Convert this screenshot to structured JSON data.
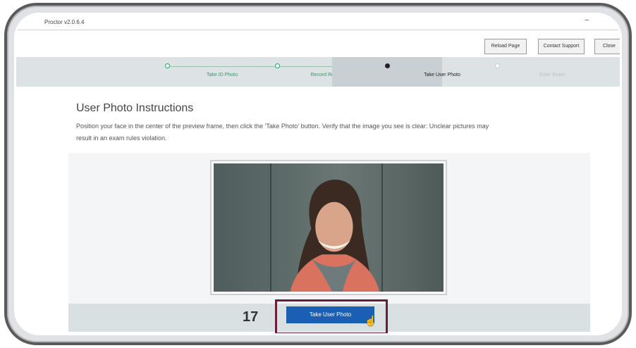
{
  "window": {
    "title": "Proctor v2.0.6.4",
    "minimize_glyph": "–"
  },
  "toolbar": {
    "reload_label": "Reload Page",
    "support_label": "Contact Support",
    "close_label": "Close"
  },
  "steps": [
    {
      "label": "Take ID Photo",
      "state": "completed"
    },
    {
      "label": "Record Room Scan",
      "state": "completed"
    },
    {
      "label": "Take User Photo",
      "state": "active"
    },
    {
      "label": "Enter Exam",
      "state": "pending"
    }
  ],
  "main": {
    "heading": "User Photo Instructions",
    "instructions": "Position your face in the center of the preview frame, then click the 'Take Photo' button. Verify that the image you see is clear: Unclear pictures may result in an exam rules violation.",
    "take_photo_label": "Take User Photo"
  },
  "annotation": {
    "step_number": "17"
  },
  "colors": {
    "accent_blue": "#1a5fb4",
    "step_complete_green": "#2e9b65",
    "highlight_border": "#6b1e3c"
  }
}
